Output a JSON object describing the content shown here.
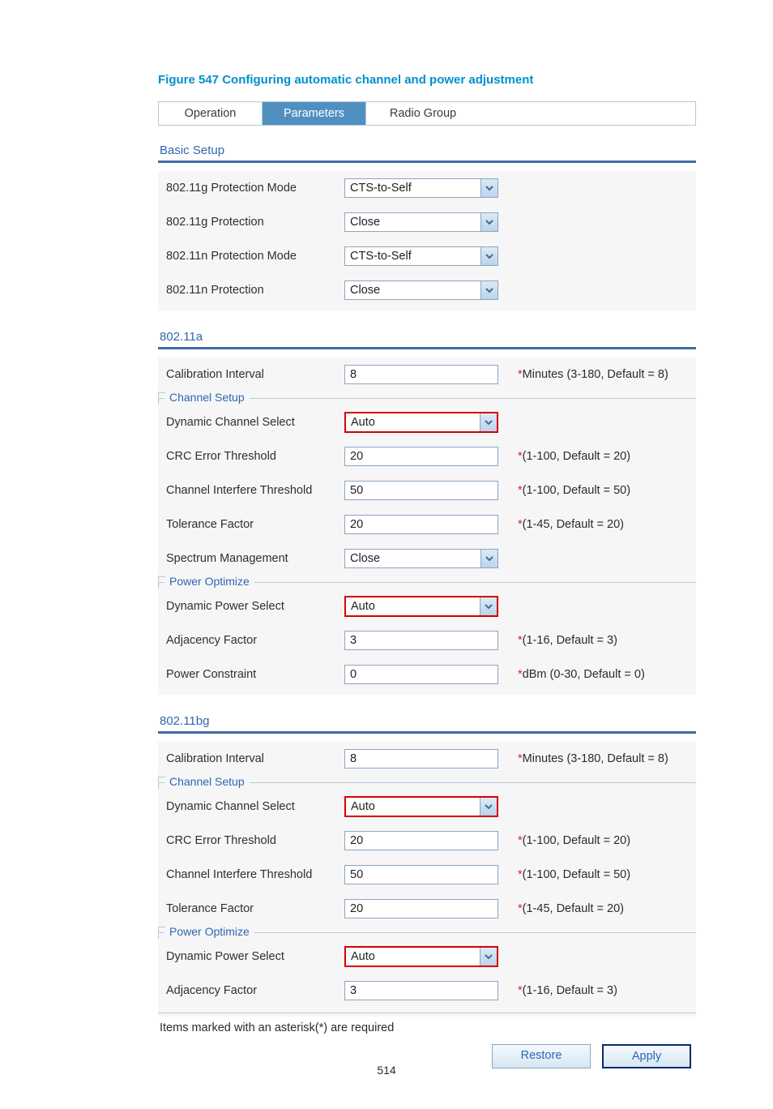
{
  "figure_title": "Figure 547 Configuring automatic channel and power adjustment",
  "tabs": {
    "operation": "Operation",
    "parameters": "Parameters",
    "radio_group": "Radio Group"
  },
  "basic_setup": {
    "title": "Basic Setup",
    "g_protection_mode_label": "802.11g Protection Mode",
    "g_protection_mode_value": "CTS-to-Self",
    "g_protection_label": "802.11g Protection",
    "g_protection_value": "Close",
    "n_protection_mode_label": "802.11n Protection Mode",
    "n_protection_mode_value": "CTS-to-Self",
    "n_protection_label": "802.11n Protection",
    "n_protection_value": "Close"
  },
  "a": {
    "title": "802.11a",
    "calibration_label": "Calibration Interval",
    "calibration_value": "8",
    "calibration_hint": "Minutes (3-180, Default = 8)",
    "channel_setup_legend": "Channel Setup",
    "dcs_label": "Dynamic Channel Select",
    "dcs_value": "Auto",
    "crc_label": "CRC Error Threshold",
    "crc_value": "20",
    "crc_hint": "(1-100, Default = 20)",
    "interfere_label": "Channel Interfere Threshold",
    "interfere_value": "50",
    "interfere_hint": "(1-100, Default = 50)",
    "tolerance_label": "Tolerance Factor",
    "tolerance_value": "20",
    "tolerance_hint": "(1-45, Default = 20)",
    "spectrum_label": "Spectrum Management",
    "spectrum_value": "Close",
    "power_optimize_legend": "Power Optimize",
    "dps_label": "Dynamic Power Select",
    "dps_value": "Auto",
    "adj_label": "Adjacency Factor",
    "adj_value": "3",
    "adj_hint": "(1-16, Default = 3)",
    "pc_label": "Power Constraint",
    "pc_value": "0",
    "pc_hint": "dBm (0-30, Default = 0)"
  },
  "bg": {
    "title": "802.11bg",
    "calibration_label": "Calibration Interval",
    "calibration_value": "8",
    "calibration_hint": "Minutes (3-180, Default = 8)",
    "channel_setup_legend": "Channel Setup",
    "dcs_label": "Dynamic Channel Select",
    "dcs_value": "Auto",
    "crc_label": "CRC Error Threshold",
    "crc_value": "20",
    "crc_hint": "(1-100, Default = 20)",
    "interfere_label": "Channel Interfere Threshold",
    "interfere_value": "50",
    "interfere_hint": "(1-100, Default = 50)",
    "tolerance_label": "Tolerance Factor",
    "tolerance_value": "20",
    "tolerance_hint": "(1-45, Default = 20)",
    "power_optimize_legend": "Power Optimize",
    "dps_label": "Dynamic Power Select",
    "dps_value": "Auto",
    "adj_label": "Adjacency Factor",
    "adj_value": "3",
    "adj_hint": "(1-16, Default = 3)"
  },
  "footnote": "Items marked with an asterisk(*) are required",
  "buttons": {
    "restore": "Restore",
    "apply": "Apply"
  },
  "page_number": "514",
  "asterisk": "*"
}
